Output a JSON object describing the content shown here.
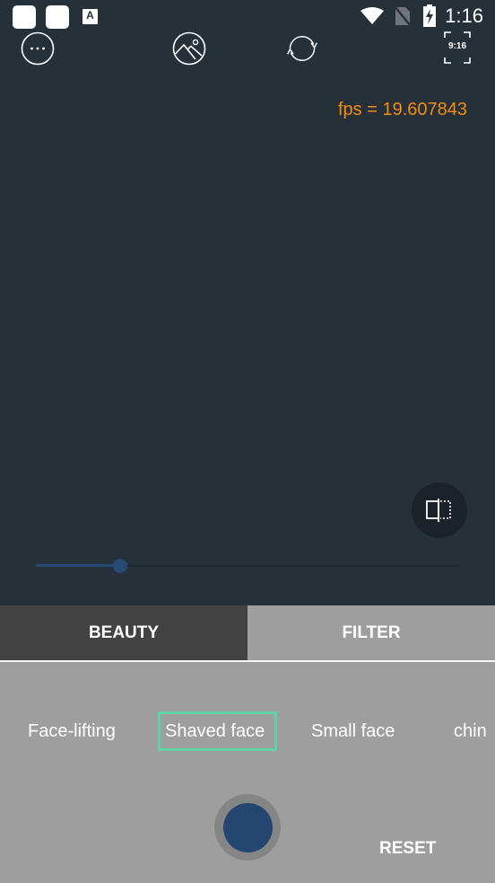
{
  "status_bar": {
    "time": "1:16",
    "notification_icons": [
      "app-notification-icon",
      "app-notification-icon",
      "text-input-icon"
    ],
    "notification_letter": "A",
    "system_icons": [
      "wifi-icon",
      "no-sim-icon",
      "battery-charging-icon"
    ]
  },
  "toolbar": {
    "more_icon": "more-options-icon",
    "gallery_icon": "gallery-icon",
    "switch_camera_icon": "switch-camera-icon",
    "aspect_ratio_label": "9:16"
  },
  "preview": {
    "fps_text": "fps = 19.607843",
    "fps_color": "#f28c13",
    "compare_icon": "compare-icon"
  },
  "slider": {
    "value_fraction": 0.2
  },
  "tabs": [
    {
      "label": "BEAUTY",
      "selected": true
    },
    {
      "label": "FILTER",
      "selected": false
    }
  ],
  "options": [
    {
      "label": "Face-lifting",
      "selected": false
    },
    {
      "label": "Shaved face",
      "selected": true
    },
    {
      "label": "Small face",
      "selected": false
    },
    {
      "label": "chin",
      "selected": false
    }
  ],
  "controls": {
    "reset_label": "RESET",
    "shutter_color": "#254670",
    "selected_border_color": "#5fd3a5"
  }
}
